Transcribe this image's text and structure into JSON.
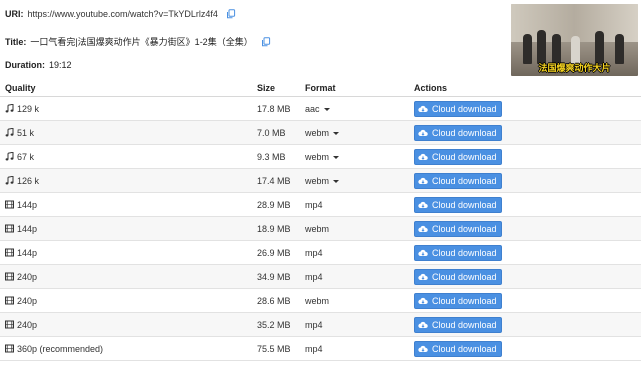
{
  "video": {
    "uri_label": "URI:",
    "uri": "https://www.youtube.com/watch?v=TkYDLrlz4f4",
    "title_label": "Title:",
    "title": "一口气看完|法国爆爽动作片《暴力街区》1-2集（全集）",
    "duration_label": "Duration:",
    "duration": "19:12",
    "thumbnail_caption": "法国爆爽动作大片"
  },
  "table": {
    "headers": {
      "quality": "Quality",
      "size": "Size",
      "format": "Format",
      "actions": "Actions"
    },
    "rows": [
      {
        "type": "audio",
        "quality": "129 k",
        "size": "17.8 MB",
        "format": "aac",
        "dropdown": true,
        "action": "Cloud download"
      },
      {
        "type": "audio",
        "quality": "51 k",
        "size": "7.0 MB",
        "format": "webm",
        "dropdown": true,
        "action": "Cloud download"
      },
      {
        "type": "audio",
        "quality": "67 k",
        "size": "9.3 MB",
        "format": "webm",
        "dropdown": true,
        "action": "Cloud download"
      },
      {
        "type": "audio",
        "quality": "126 k",
        "size": "17.4 MB",
        "format": "webm",
        "dropdown": true,
        "action": "Cloud download"
      },
      {
        "type": "video",
        "quality": "144p",
        "size": "28.9 MB",
        "format": "mp4",
        "dropdown": false,
        "action": "Cloud download"
      },
      {
        "type": "video",
        "quality": "144p",
        "size": "18.9 MB",
        "format": "webm",
        "dropdown": false,
        "action": "Cloud download"
      },
      {
        "type": "video",
        "quality": "144p",
        "size": "26.9 MB",
        "format": "mp4",
        "dropdown": false,
        "action": "Cloud download"
      },
      {
        "type": "video",
        "quality": "240p",
        "size": "34.9 MB",
        "format": "mp4",
        "dropdown": false,
        "action": "Cloud download"
      },
      {
        "type": "video",
        "quality": "240p",
        "size": "28.6 MB",
        "format": "webm",
        "dropdown": false,
        "action": "Cloud download"
      },
      {
        "type": "video",
        "quality": "240p",
        "size": "35.2 MB",
        "format": "mp4",
        "dropdown": false,
        "action": "Cloud download"
      },
      {
        "type": "video",
        "quality": "360p (recommended)",
        "size": "75.5 MB",
        "format": "mp4",
        "dropdown": false,
        "action": "Cloud download"
      }
    ]
  },
  "colors": {
    "button": "#4a90e2",
    "stripe": "#f7f7f7",
    "copy_icon": "#4a90e2"
  },
  "icons": {
    "audio": "music-note-icon",
    "video": "film-icon",
    "copy": "copy-icon",
    "cloud": "cloud-download-icon",
    "caret": "caret-down-icon"
  }
}
